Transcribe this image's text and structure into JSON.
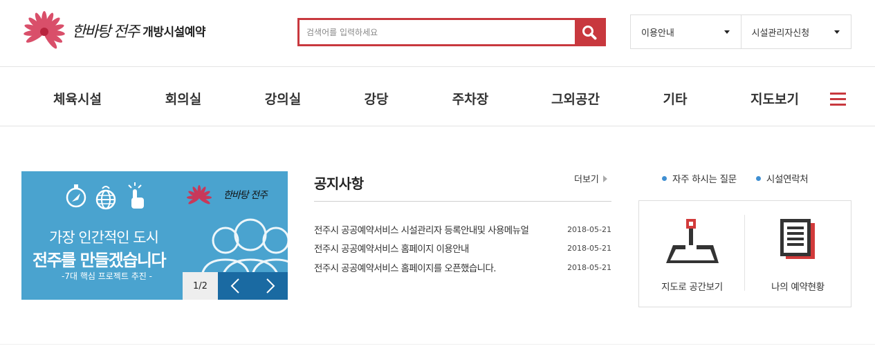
{
  "header": {
    "logo_script": "한바탕 전주",
    "logo_title": "개방시설예약",
    "search": {
      "placeholder": "검색어를 입력하세요",
      "value": ""
    },
    "util_menu": [
      {
        "label": "이용안내"
      },
      {
        "label": "시설관리자신청"
      }
    ]
  },
  "gnb": {
    "items": [
      {
        "label": "체육시설"
      },
      {
        "label": "회의실"
      },
      {
        "label": "강의실"
      },
      {
        "label": "강당"
      },
      {
        "label": "주차장"
      },
      {
        "label": "그외공간"
      },
      {
        "label": "기타"
      },
      {
        "label": "지도보기"
      }
    ]
  },
  "banner": {
    "logo_text": "한바탕 전주",
    "line1": "가장 인간적인 도시",
    "line2": "전주를 만들겠습니다",
    "sub": "-7대 핵심 프로젝트 추진 -",
    "pager": "1/2"
  },
  "notice": {
    "title": "공지사항",
    "more": "더보기",
    "items": [
      {
        "title": "전주시 공공예약서비스 시설관리자 등록안내및 사용메뉴얼",
        "date": "2018-05-21"
      },
      {
        "title": "전주시 공공예약서비스 홈페이지 이용안내",
        "date": "2018-05-21"
      },
      {
        "title": "전주시 공공예약서비스 홈페이지를 오픈했습니다.",
        "date": "2018-05-21"
      }
    ]
  },
  "quick": {
    "links": [
      {
        "label": "자주 하시는 질문"
      },
      {
        "label": "시설연락처"
      }
    ],
    "cards": [
      {
        "label": "지도로 공간보기",
        "icon": "map-pin-icon"
      },
      {
        "label": "나의 예약현황",
        "icon": "document-icon"
      }
    ]
  },
  "colors": {
    "accent": "#c8383e",
    "banner_bg": "#4aa3cf",
    "pager_bg": "#1a6aa2",
    "dot": "#3f8fd2"
  }
}
